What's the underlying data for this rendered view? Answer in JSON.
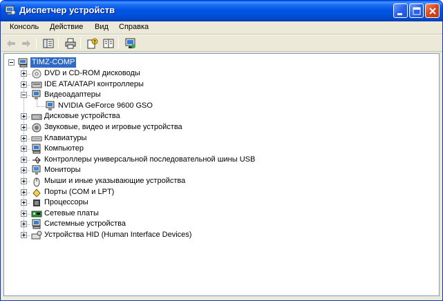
{
  "window": {
    "title": "Диспетчер устройств"
  },
  "menu": [
    "Консоль",
    "Действие",
    "Вид",
    "Справка"
  ],
  "toolbar": {
    "buttons": [
      "back-arrow-icon",
      "forward-arrow-icon",
      "show-hide-tree-icon",
      "print-icon",
      "properties-help-icon",
      "properties-icon",
      "scan-hardware-icon"
    ]
  },
  "tree": {
    "root": "TIMZ-COMP",
    "categories": [
      {
        "label": "DVD и CD-ROM дисководы",
        "icon": "cdrom-icon",
        "expanded": false
      },
      {
        "label": "IDE ATA/ATAPI контроллеры",
        "icon": "ide-controller-icon",
        "expanded": false
      },
      {
        "label": "Видеоадаптеры",
        "icon": "display-adapter-icon",
        "expanded": true,
        "children": [
          "NVIDIA GeForce 9600 GSO"
        ]
      },
      {
        "label": "Дисковые устройства",
        "icon": "disk-drive-icon",
        "expanded": false
      },
      {
        "label": "Звуковые, видео и игровые устройства",
        "icon": "sound-device-icon",
        "expanded": false
      },
      {
        "label": "Клавиатуры",
        "icon": "keyboard-icon",
        "expanded": false
      },
      {
        "label": "Компьютер",
        "icon": "computer-icon",
        "expanded": false
      },
      {
        "label": "Контроллеры универсальной последовательной шины USB",
        "icon": "usb-icon",
        "expanded": false
      },
      {
        "label": "Мониторы",
        "icon": "monitor-icon",
        "expanded": false
      },
      {
        "label": "Мыши и иные указывающие устройства",
        "icon": "mouse-icon",
        "expanded": false
      },
      {
        "label": "Порты (COM и LPT)",
        "icon": "port-icon",
        "expanded": false
      },
      {
        "label": "Процессоры",
        "icon": "processor-icon",
        "expanded": false
      },
      {
        "label": "Сетевые платы",
        "icon": "network-card-icon",
        "expanded": false
      },
      {
        "label": "Системные устройства",
        "icon": "system-device-icon",
        "expanded": false
      },
      {
        "label": "Устройства HID (Human Interface Devices)",
        "icon": "hid-icon",
        "expanded": false
      }
    ]
  },
  "colors": {
    "selection": "#316ac5",
    "titlebar": "#0055e5"
  }
}
